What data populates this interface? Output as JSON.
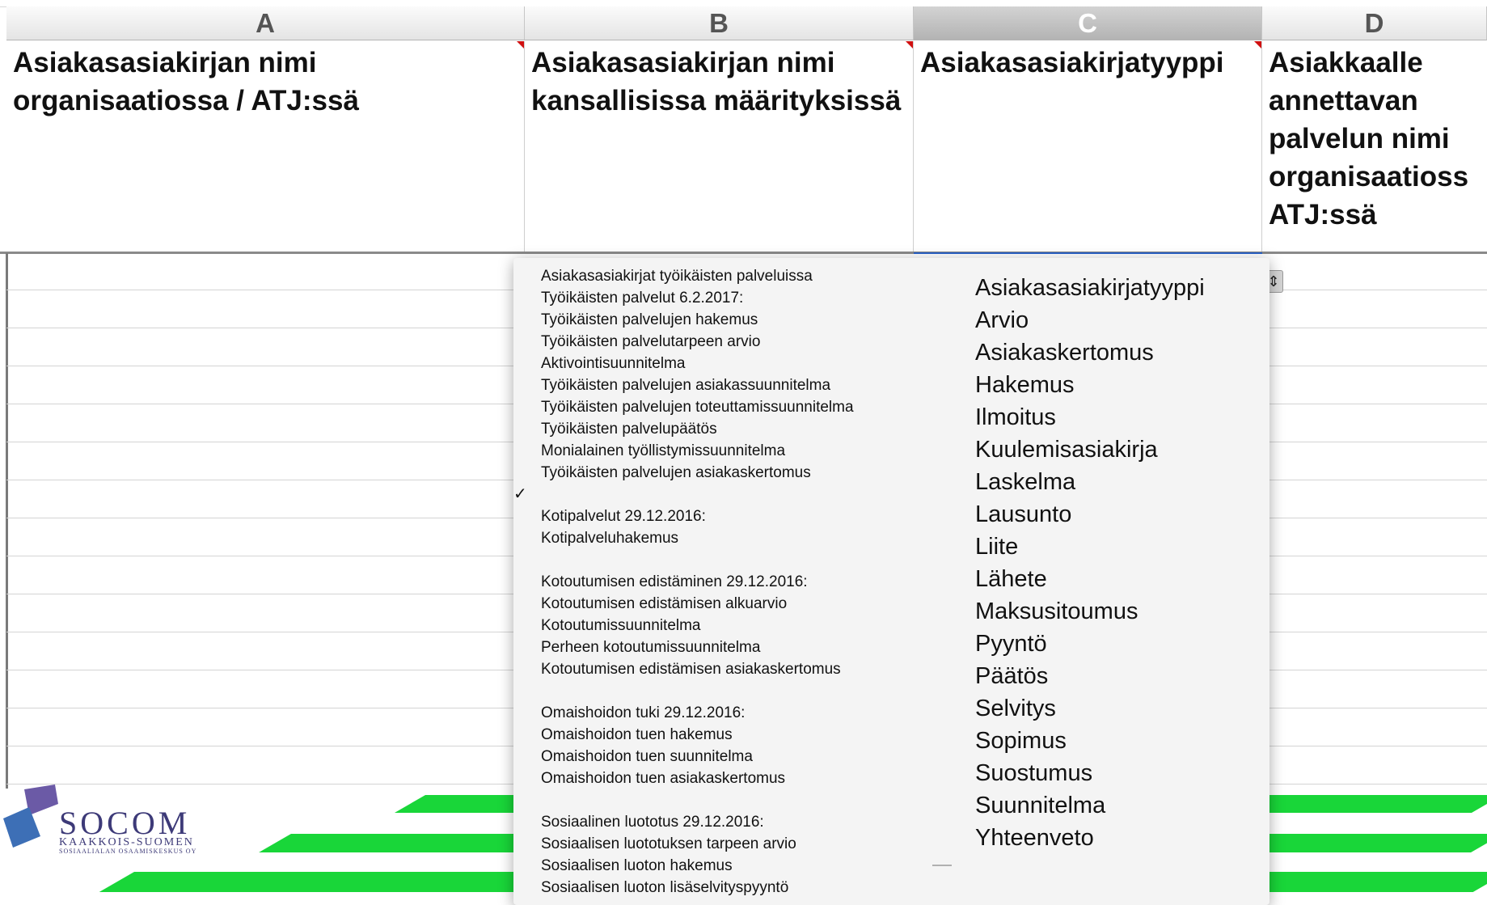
{
  "columns": [
    "A",
    "B",
    "C",
    "D"
  ],
  "headers": [
    "Asiakasasiakirjan nimi organisaatiossa / ATJ:ssä",
    "Asiakasasiakirjan nimi kansallisissa määrityksissä",
    "Asiakasasiakirjatyyppi",
    "Asiakkaalle annettavan palvelun nimi organisaatioss ATJ:ssä"
  ],
  "dropdown_arrow": "⇕",
  "left_menu": [
    "Asiakasasiakirjat työikäisten palveluissa",
    "Työikäisten palvelut 6.2.2017:",
    "Työikäisten palvelujen hakemus",
    "Työikäisten palvelutarpeen arvio",
    "Aktivointisuunnitelma",
    "Työikäisten palvelujen asiakassuunnitelma",
    "Työikäisten palvelujen toteuttamissuunnitelma",
    "Työikäisten palvelupäätös",
    "Monialainen työllistymissuunnitelma",
    "Työikäisten palvelujen asiakaskertomus",
    "",
    "Kotipalvelut 29.12.2016:",
    "Kotipalveluhakemus",
    "",
    "Kotoutumisen edistäminen 29.12.2016:",
    "Kotoutumisen edistämisen alkuarvio",
    "Kotoutumissuunnitelma",
    "Perheen kotoutumissuunnitelma",
    "Kotoutumisen edistämisen asiakaskertomus",
    "",
    "Omaishoidon tuki 29.12.2016:",
    "Omaishoidon tuen hakemus",
    "Omaishoidon tuen suunnitelma",
    "Omaishoidon tuen asiakaskertomus",
    "",
    "Sosiaalinen luototus 29.12.2016:",
    "Sosiaalisen luototuksen tarpeen arvio",
    "Sosiaalisen luoton hakemus",
    "Sosiaalisen luoton lisäselvityspyyntö"
  ],
  "checked_index": 10,
  "checkmark": "✓",
  "right_menu": [
    "Asiakasasiakirjatyyppi",
    "Arvio",
    "Asiakaskertomus",
    "Hakemus",
    "Ilmoitus",
    "Kuulemisasiakirja",
    "Laskelma",
    "Lausunto",
    "Liite",
    "Lähete",
    "Maksusitoumus",
    "Pyyntö",
    "Päätös",
    "Selvitys",
    "Sopimus",
    "Suostumus",
    "Suunnitelma",
    "Yhteenveto"
  ],
  "logo": {
    "title": "SOCOM",
    "subtitle": "KAAKKOIS-SUOMEN",
    "subtitle2": "SOSIAALIALAN OSAAMISKESKUS OY",
    "colors": {
      "purple": "#6b5aa6",
      "blue": "#3d6fb6",
      "text": "#3d3a78"
    }
  },
  "colors": {
    "brand_green": "#19d639",
    "selection_blue": "#2a63c9"
  }
}
